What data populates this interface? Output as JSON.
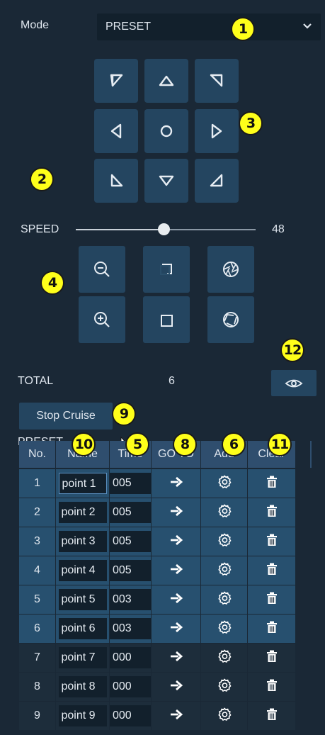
{
  "mode": {
    "label": "Mode",
    "value": "PRESET"
  },
  "speed": {
    "label": "SPEED",
    "value": 48,
    "fraction": 0.49
  },
  "total": {
    "label": "TOTAL",
    "value": "6"
  },
  "stop_cruise_label": "Stop Cruise",
  "preset_label": "PRESET",
  "badges": {
    "mode_select": "1",
    "speed": "2",
    "ptz": "3",
    "zoom_focus": "4",
    "time": "5",
    "add": "6",
    "goto": "8",
    "stop_cruise": "9",
    "name": "10",
    "clear": "11",
    "view": "12"
  },
  "table": {
    "headers": [
      "No.",
      "Name",
      "Time",
      "GO TO",
      "Add",
      "Clear"
    ],
    "rows": [
      {
        "no": "1",
        "name": "point 1",
        "time": "005",
        "selected": true
      },
      {
        "no": "2",
        "name": "point 2",
        "time": "005",
        "selected": true
      },
      {
        "no": "3",
        "name": "point 3",
        "time": "005",
        "selected": true
      },
      {
        "no": "4",
        "name": "point 4",
        "time": "005",
        "selected": true
      },
      {
        "no": "5",
        "name": "point 5",
        "time": "003",
        "selected": true
      },
      {
        "no": "6",
        "name": "point 6",
        "time": "003",
        "selected": true
      },
      {
        "no": "7",
        "name": "point 7",
        "time": "000",
        "selected": false
      },
      {
        "no": "8",
        "name": "point 8",
        "time": "000",
        "selected": false
      },
      {
        "no": "9",
        "name": "point 9",
        "time": "000",
        "selected": false
      }
    ]
  },
  "icons": {
    "ptz": [
      "up-left-arrow-icon",
      "up-arrow-icon",
      "up-right-arrow-icon",
      "left-arrow-icon",
      "center-circle-icon",
      "right-arrow-icon",
      "down-left-arrow-icon",
      "down-arrow-icon",
      "down-right-arrow-icon"
    ],
    "zoom": [
      "zoom-out-icon",
      "focus-near-icon",
      "iris-close-icon",
      "zoom-in-icon",
      "focus-far-icon",
      "iris-open-icon"
    ],
    "row": [
      "goto-arrow-icon",
      "gear-icon",
      "trash-icon"
    ],
    "view": "eye-icon"
  },
  "colors": {
    "background": "#1a2836",
    "button": "#244560",
    "badge": "#ffff1a",
    "selected_row": "#27506f"
  }
}
